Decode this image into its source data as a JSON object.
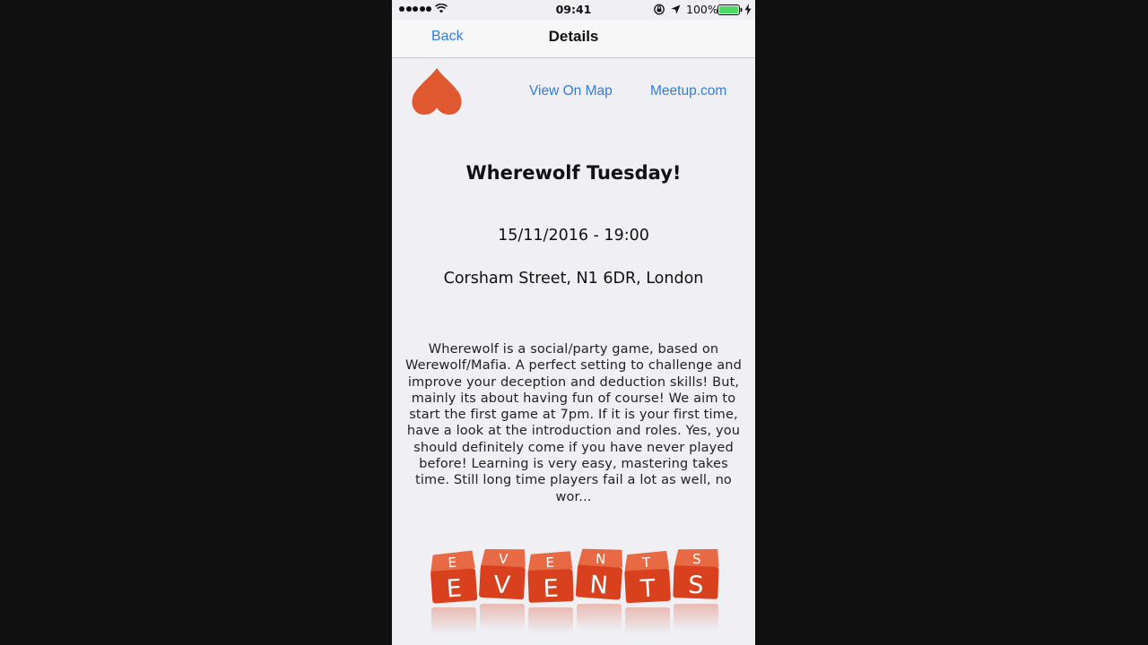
{
  "status_bar": {
    "time": "09:41",
    "battery_percent": "100%",
    "signal_bars": 5,
    "battery_level": 1.0
  },
  "nav": {
    "back_label": "Back",
    "title": "Details"
  },
  "actions": {
    "map_label": "View On Map",
    "meetup_label": "Meetup.com"
  },
  "event": {
    "title": "Wherewolf Tuesday!",
    "datetime": "15/11/2016 - 19:00",
    "location": "Corsham Street, N1 6DR, London",
    "description": "Wherewolf is a social/party game, based on Werewolf/Mafia. A perfect setting to challenge and improve your deception and deduction skills! But, mainly its about having fun of course! We aim to start the first game at 7pm. If it is your first time, have a look at the introduction and roles. Yes, you should definitely come if you have never played before! Learning is very easy, mastering takes time. Still long time players fail a lot as well, no wor..."
  },
  "image": {
    "letters_top": [
      "E",
      "V",
      "E",
      "N",
      "T",
      "S"
    ],
    "letters_front": [
      "E",
      "V",
      "E",
      "N",
      "T",
      "S"
    ]
  },
  "colors": {
    "accent_blue": "#2f7ee0",
    "heart_orange": "#e0582f",
    "dice_red": "#d9411e"
  },
  "icons": {
    "wifi": "wifi-icon",
    "orientation_lock": "orientation-lock-icon",
    "location": "location-arrow-icon",
    "battery": "battery-icon",
    "charging": "charging-bolt-icon",
    "logo": "heart-logo-icon"
  }
}
